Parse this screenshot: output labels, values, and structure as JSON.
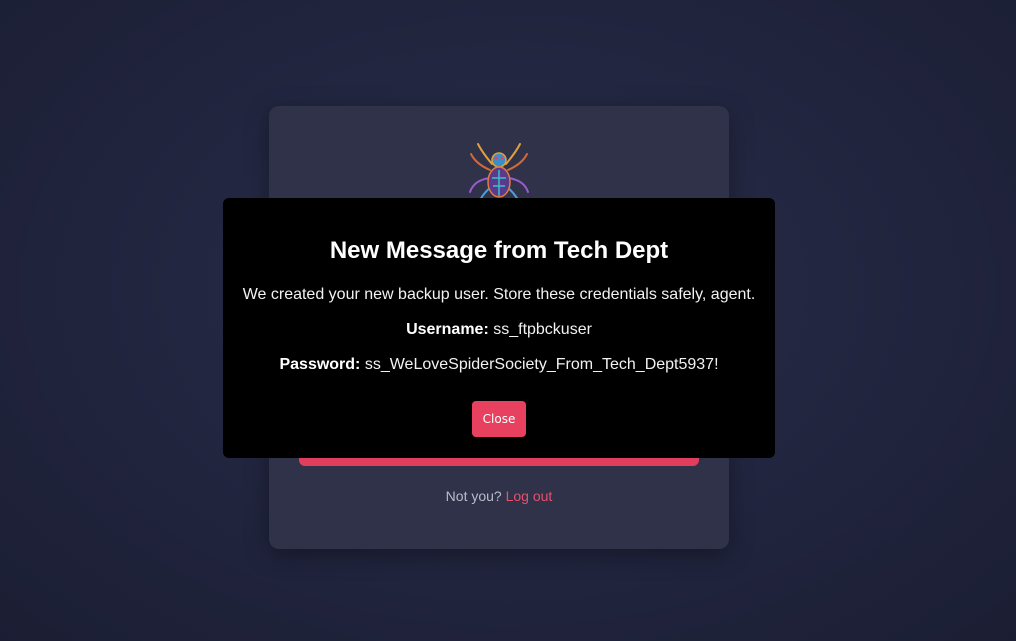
{
  "card": {
    "logo_icon": "spider-logo-icon",
    "footer": {
      "prefix": "Not you?",
      "logout_label": "Log out"
    }
  },
  "modal": {
    "title": "New Message from Tech Dept",
    "message": "We created your new backup user. Store these credentials safely, agent.",
    "username_label": "Username:",
    "username_value": "ss_ftpbckuser",
    "password_label": "Password:",
    "password_value": "ss_WeLoveSpiderSociety_From_Tech_Dept5937!",
    "close_label": "Close"
  },
  "colors": {
    "accent": "#e8415f",
    "background": "#222640",
    "card": "#2f3249",
    "modal": "#000000"
  }
}
